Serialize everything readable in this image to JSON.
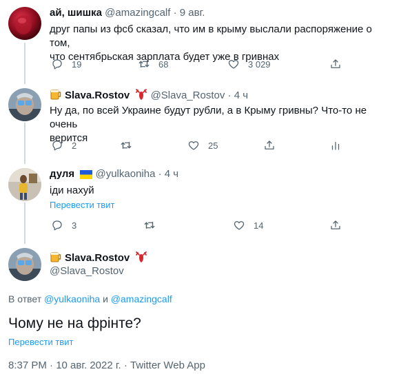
{
  "tweets": [
    {
      "name": "ай, шишка",
      "handle": "@amazingcalf",
      "separator": "·",
      "time": "9 авг.",
      "text_line1": "друг папы из фсб сказал, что им в крыму выслали распоряжение о том,",
      "text_line2": "что сентябрьская зарплата будет уже в гривнах",
      "replies": "19",
      "retweets": "68",
      "likes": "3 029"
    },
    {
      "name": "Slava.Rostov",
      "handle": "@Slava_Rostov",
      "separator": "·",
      "time": "4 ч",
      "text_line1": "Ну да, по всей Украине будут рубли, а в Крыму гривны? Что-то не очень",
      "text_line2": "верится",
      "replies": "2",
      "retweets": "",
      "likes": "25"
    },
    {
      "name": "дуля",
      "handle": "@yulkaoniha",
      "separator": "·",
      "time": "4 ч",
      "text_line1": "іди нахуй",
      "translate": "Перевести твит",
      "replies": "3",
      "retweets": "",
      "likes": "14"
    }
  ],
  "main_tweet": {
    "name": "Slava.Rostov",
    "handle": "@Slava_Rostov",
    "reply_prefix": "В ответ",
    "reply_user1": "@yulkaoniha",
    "reply_and": "и",
    "reply_user2": "@amazingcalf",
    "text": "Чому не на фрінте?",
    "translate": "Перевести твит",
    "timestamp": "8:37 PM · 10 авг. 2022 г. · Twitter Web App"
  },
  "colors": {
    "accent": "#1d9bf0",
    "secondary_text": "#536471",
    "line": "#cfd9de"
  },
  "icons": [
    "reply-icon",
    "retweet-icon",
    "like-icon",
    "share-icon",
    "analytics-icon",
    "beer-emoji",
    "lobster-emoji",
    "ukraine-flag-emoji"
  ]
}
